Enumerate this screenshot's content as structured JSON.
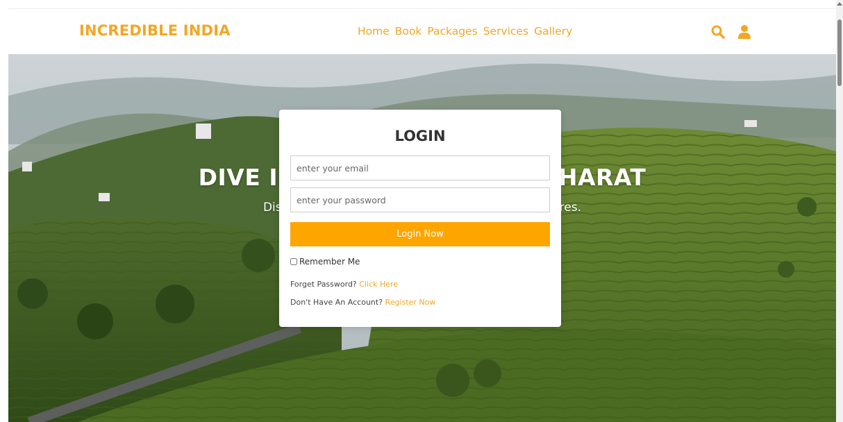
{
  "brand": {
    "logo": "INCREDIBLE INDIA",
    "accent": "#f5a623",
    "button": "#ffa500"
  },
  "nav": [
    {
      "label": "Home"
    },
    {
      "label": "Book"
    },
    {
      "label": "Packages"
    },
    {
      "label": "Services"
    },
    {
      "label": "Gallery"
    }
  ],
  "header_icons": [
    "search-icon",
    "user-icon"
  ],
  "hero": {
    "title": "DIVE INTO THE HEART OF BHARAT",
    "subtitle": "Discover the diverse landscapes and vibrant cultures."
  },
  "login": {
    "title": "LOGIN",
    "email_placeholder": "enter your email",
    "password_placeholder": "enter your password",
    "button": "Login Now",
    "remember": "Remember Me",
    "forget_prefix": "Forget Password? ",
    "forget_link": "Click Here",
    "account_prefix": "Don't Have An Account? ",
    "register_link": "Register Now"
  }
}
